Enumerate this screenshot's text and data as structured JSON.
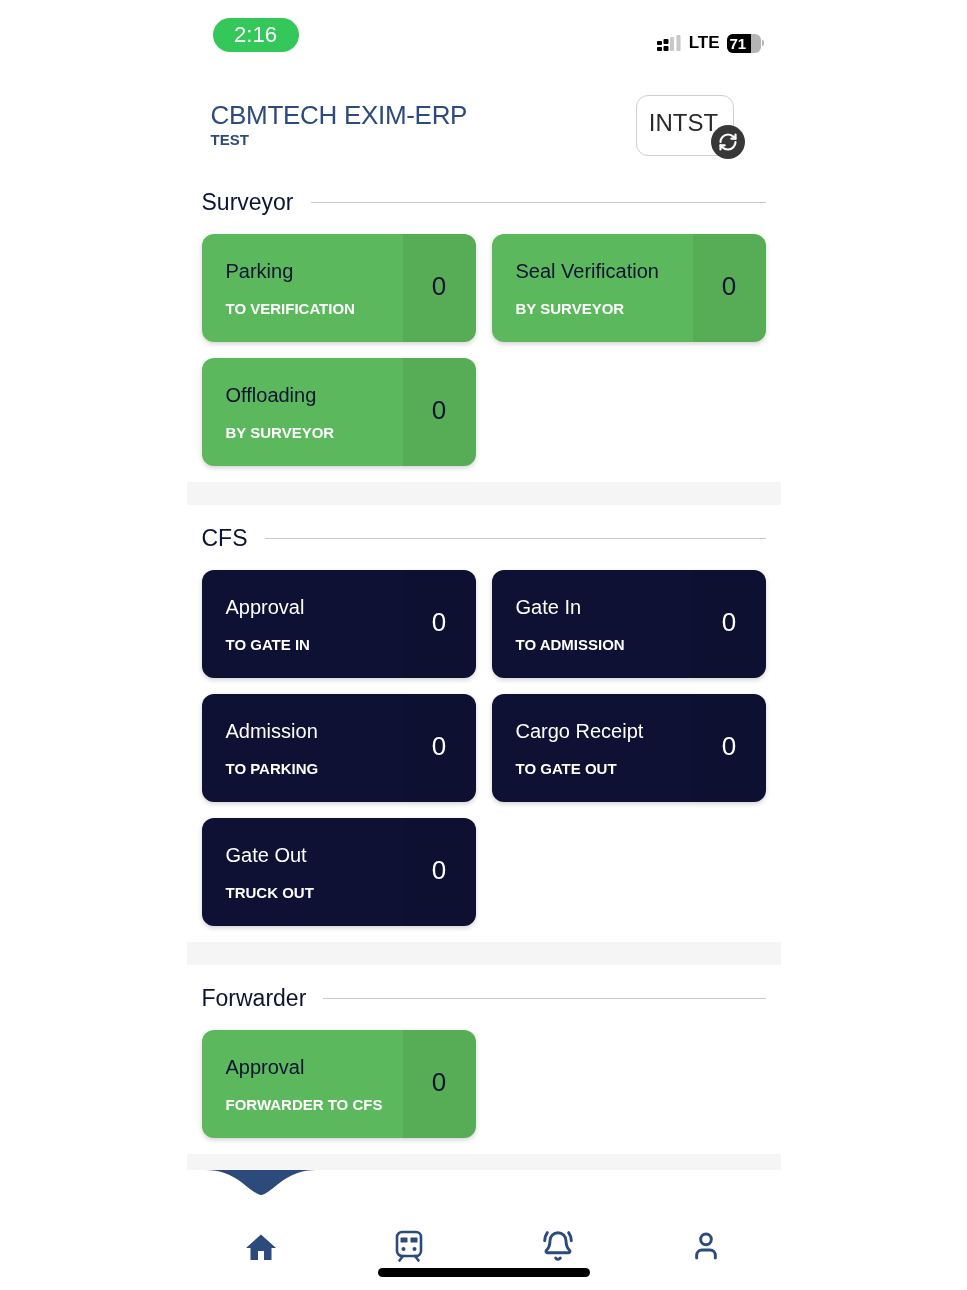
{
  "status_bar": {
    "time": "2:16",
    "network": "LTE",
    "battery": "71"
  },
  "header": {
    "title": "CBMTECH EXIM-ERP",
    "subtitle": "TEST",
    "branch_button": "INTST"
  },
  "sections": [
    {
      "title": "Surveyor",
      "color": "#5cb85c",
      "cards": [
        {
          "title": "Parking",
          "subtitle": "TO VERIFICATION",
          "count": "0"
        },
        {
          "title": "Seal Verification",
          "subtitle": "BY SURVEYOR",
          "count": "0"
        },
        {
          "title": "Offloading",
          "subtitle": "BY SURVEYOR",
          "count": "0"
        }
      ]
    },
    {
      "title": "CFS",
      "color": "#0e1133",
      "cards": [
        {
          "title": "Approval",
          "subtitle": "TO GATE IN",
          "count": "0"
        },
        {
          "title": "Gate In",
          "subtitle": "TO ADMISSION",
          "count": "0"
        },
        {
          "title": "Admission",
          "subtitle": "TO PARKING",
          "count": "0"
        },
        {
          "title": "Cargo Receipt",
          "subtitle": "TO GATE OUT",
          "count": "0"
        },
        {
          "title": "Gate Out",
          "subtitle": "TRUCK OUT",
          "count": "0"
        }
      ]
    },
    {
      "title": "Forwarder",
      "color": "#5cb85c",
      "cards": [
        {
          "title": "Approval",
          "subtitle": "FORWARDER TO CFS",
          "count": "0"
        }
      ]
    }
  ],
  "tab_bar": {
    "tabs": [
      {
        "selected": true
      },
      {
        "selected": false
      },
      {
        "selected": false
      },
      {
        "selected": false
      }
    ]
  }
}
